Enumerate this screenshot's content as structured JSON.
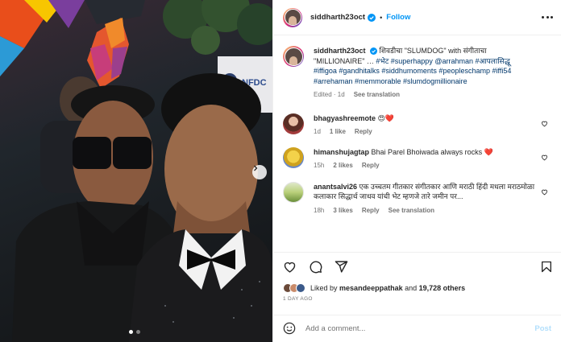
{
  "post": {
    "username": "siddharth23oct",
    "follow_label": "Follow",
    "separator": "•"
  },
  "caption": {
    "username": "siddharth23oct",
    "text": "शिवडीचा \"SLUMDOG\" with संगीताचा \"MILLIONAIRE\" … ",
    "tags": "#भेट #superhappy @arrahman #आपलासिद्धू #iffigoa #gandhitalks #siddhumoments #peopleschamp #iffi54 #arrehaman #memmorable #slumdogmillionaire",
    "edited": "Edited",
    "time": "1d",
    "translation": "See translation"
  },
  "comments": [
    {
      "username": "bhagyashreemote",
      "text": "😍❤️",
      "time": "1d",
      "likes": "1 like",
      "reply": "Reply",
      "translation": ""
    },
    {
      "username": "himanshujagtap",
      "text": "Bhai Parel Bhoiwada always rocks ❤️",
      "time": "15h",
      "likes": "2 likes",
      "reply": "Reply",
      "translation": ""
    },
    {
      "username": "anantsalvi26",
      "text": "एक उच्चतम गीतकार संगीतकार आणि मराठी हिंदी मधला मराठमोळा कलाकार सिद्धार्थ जाधव यांची भेट म्हणजे तारे जमीन पर...",
      "time": "18h",
      "likes": "3 likes",
      "reply": "Reply",
      "translation": "See translation"
    }
  ],
  "likes": {
    "prefix": "Liked by",
    "user": "mesandeeppathak",
    "joiner": "and",
    "count": "19,728 others"
  },
  "timeago": "1 DAY AGO",
  "add_comment": {
    "placeholder": "Add a comment...",
    "post_label": "Post"
  },
  "icons": {
    "verified": "verified-badge-icon",
    "like": "heart-icon",
    "comment": "comment-icon",
    "share": "share-icon",
    "save": "bookmark-icon",
    "emoji": "smiley-icon",
    "more": "more-options-icon",
    "next": "chevron-right-icon"
  },
  "colors": {
    "accent": "#0095f6",
    "link": "#00376b",
    "secondary_text": "#737373",
    "post_disabled": "#b2dffc"
  }
}
